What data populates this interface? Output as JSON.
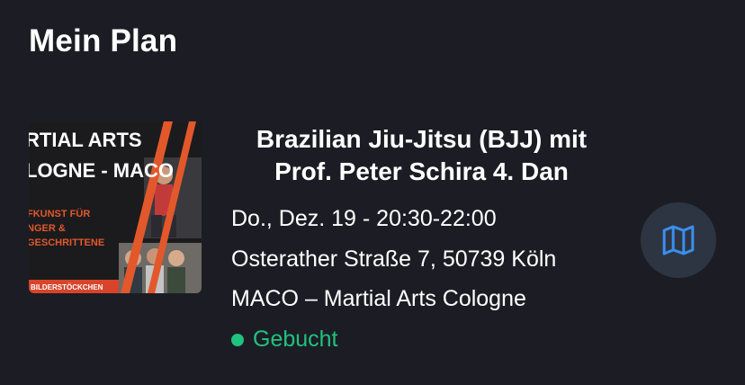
{
  "header": {
    "title": "Mein Plan"
  },
  "event": {
    "title": "Brazilian Jiu-Jitsu (BJJ) mit Prof. Peter Schira 4. Dan",
    "datetime": "Do., Dez. 19 - 20:30-22:00",
    "address": "Osterather Straße 7, 50739 Köln",
    "venue": "MACO – Martial Arts Cologne",
    "status": "Gebucht",
    "status_color": "#21c17f",
    "thumbnail": {
      "line1": "RTIAL ARTS",
      "line2": "LOGNE - MACO",
      "line3": "FKUNST FÜR",
      "line4": "NGER &",
      "line5": "GESCHRITTENE",
      "line6": "BILDERSTÖCKCHEN"
    }
  },
  "actions": {
    "map_icon": "map-icon",
    "accent": "#3a8ff0"
  }
}
